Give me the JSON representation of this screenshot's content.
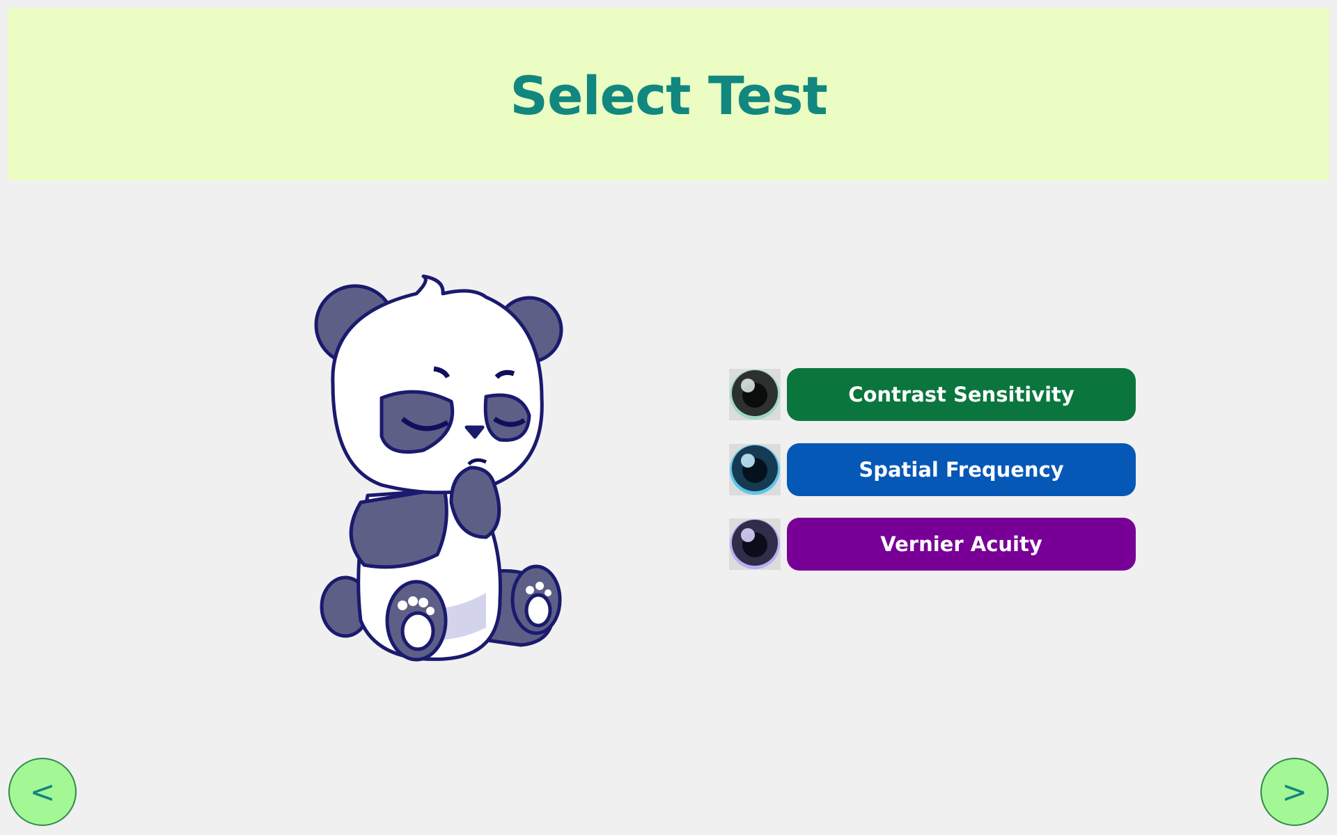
{
  "header": {
    "title": "Select Test",
    "background": "#ebfdc2",
    "title_color": "#12877f"
  },
  "illustration": {
    "icon": "panda-illustration"
  },
  "tests": [
    {
      "label": "Contrast Sensitivity",
      "color": "#0a763e",
      "icon": "eye-icon",
      "icon_tint": "#9fd8c8"
    },
    {
      "label": "Spatial Frequency",
      "color": "#0558b6",
      "icon": "eye-icon",
      "icon_tint": "#5cc6e8"
    },
    {
      "label": "Vernier Acuity",
      "color": "#780096",
      "icon": "eye-icon",
      "icon_tint": "#b7b0f2"
    }
  ],
  "navigation": {
    "prev_label": "<",
    "next_label": ">",
    "button_color": "#a4f795",
    "arrow_color": "#12877f"
  }
}
